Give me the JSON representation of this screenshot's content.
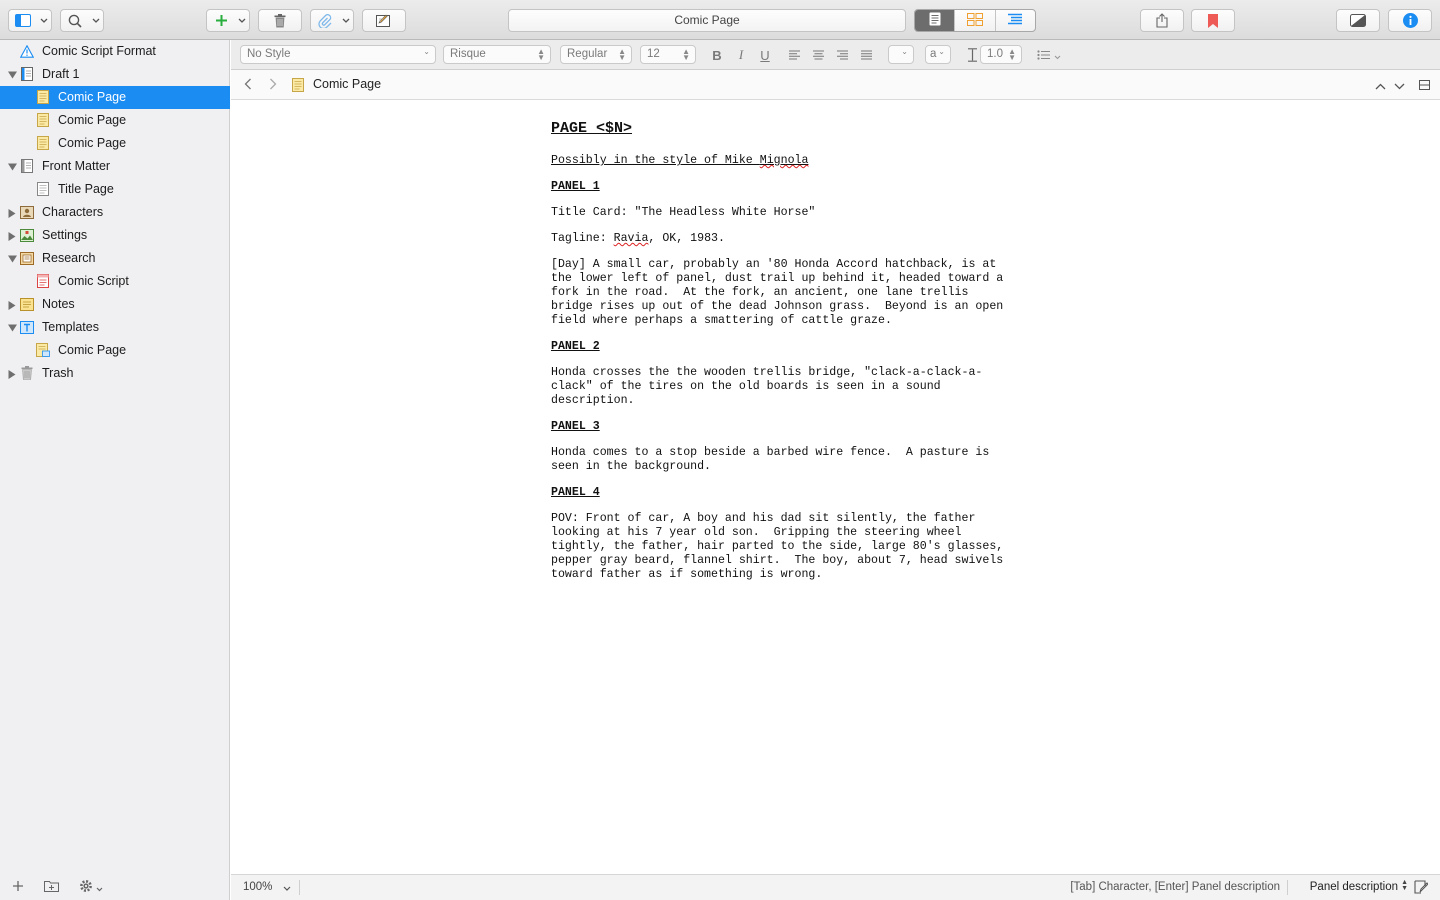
{
  "toolbar": {
    "title": "Comic Page",
    "icons": [
      "sidebar-icon",
      "search-icon",
      "plus-icon",
      "trash-icon",
      "paperclip-icon",
      "compose-icon",
      "document-view-icon",
      "corkboard-icon",
      "outline-icon",
      "share-icon",
      "bookmark-icon",
      "composition-icon",
      "info-icon"
    ],
    "colors": {
      "add": "#27ae3d",
      "bookmark": "#ee5a55",
      "info": "#1b8cf2",
      "corkboard": "#f0a030",
      "outline": "#1b8cf2"
    }
  },
  "binder": {
    "items": [
      {
        "label": "Comic Script Format",
        "level": 0,
        "icon": "warning-icon",
        "expander": "none"
      },
      {
        "label": "Draft 1",
        "level": 0,
        "icon": "draft-folder-icon",
        "expander": "open"
      },
      {
        "label": "Comic Page",
        "level": 1,
        "icon": "document-icon",
        "expander": "none",
        "selected": true
      },
      {
        "label": "Comic Page",
        "level": 1,
        "icon": "document-icon",
        "expander": "none"
      },
      {
        "label": "Comic Page",
        "level": 1,
        "icon": "document-icon",
        "expander": "none"
      },
      {
        "label": "Front Matter",
        "level": 0,
        "icon": "front-matter-icon",
        "expander": "open"
      },
      {
        "label": "Title Page",
        "level": 1,
        "icon": "page-icon",
        "expander": "none"
      },
      {
        "label": "Characters",
        "level": 0,
        "icon": "characters-icon",
        "expander": "closed"
      },
      {
        "label": "Settings",
        "level": 0,
        "icon": "settings-icon",
        "expander": "closed"
      },
      {
        "label": "Research",
        "level": 0,
        "icon": "research-icon",
        "expander": "open"
      },
      {
        "label": "Comic Script",
        "level": 1,
        "icon": "script-icon",
        "expander": "none"
      },
      {
        "label": "Notes",
        "level": 0,
        "icon": "notes-icon",
        "expander": "closed"
      },
      {
        "label": "Templates",
        "level": 0,
        "icon": "templates-icon",
        "expander": "open"
      },
      {
        "label": "Comic Page",
        "level": 1,
        "icon": "template-doc-icon",
        "expander": "none"
      },
      {
        "label": "Trash",
        "level": 0,
        "icon": "trash-icon",
        "expander": "closed"
      }
    ],
    "selection_color": "#1b8cf2"
  },
  "formatbar": {
    "style": "No Style",
    "font": "Risque",
    "weight": "Regular",
    "size": "12",
    "bold": "B",
    "italic": "I",
    "underline": "U",
    "highlight": "a",
    "line_spacing": "1.0"
  },
  "header": {
    "title": "Comic Page"
  },
  "script": {
    "heading": "PAGE <$N>",
    "style_line": {
      "before": "Possibly in the style of Mike ",
      "misspelled": "Mignola"
    },
    "panel1": "PANEL 1",
    "title_card": "Title Card: \"The Headless White Horse\"",
    "tagline": {
      "before": "Tagline: ",
      "misspelled": "Ravia",
      "after": ", OK, 1983."
    },
    "panel1_desc": "[Day] A small car, probably an '80 Honda Accord hatchback, is at\nthe lower left of panel, dust trail up behind it, headed toward a\nfork in the road.  At the fork, an ancient, one lane trellis\nbridge rises up out of the dead Johnson grass.  Beyond is an open\nfield where perhaps a smattering of cattle graze.",
    "panel2": "PANEL 2",
    "panel2_desc": "Honda crosses the the wooden trellis bridge, \"clack-a-clack-a-\nclack\" of the tires on the old boards is seen in a sound\ndescription.",
    "panel3": "PANEL 3",
    "panel3_desc": "Honda comes to a stop beside a barbed wire fence.  A pasture is\nseen in the background.",
    "panel4": "PANEL 4",
    "panel4_desc": "POV: Front of car, A boy and his dad sit silently, the father\nlooking at his 7 year old son.  Gripping the steering wheel\ntightly, the father, hair parted to the side, large 80's glasses,\npepper gray beard, flannel shirt.  The boy, about 7, head swivels\ntoward father as if something is wrong."
  },
  "footer": {
    "zoom": "100%",
    "hint": "[Tab] Character, [Enter] Panel description",
    "element": "Panel description"
  }
}
